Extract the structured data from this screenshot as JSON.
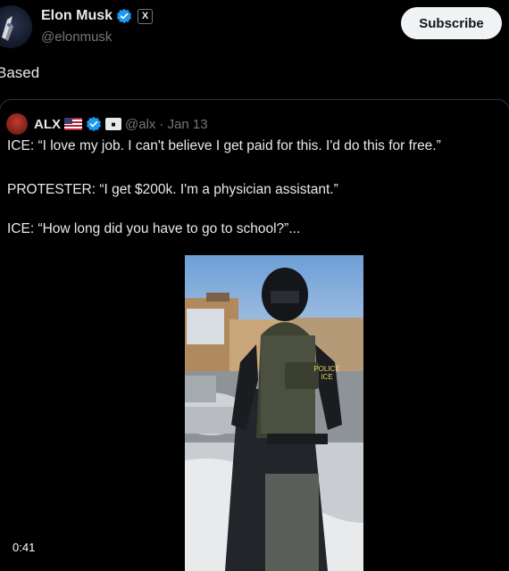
{
  "author": {
    "name": "Elon Musk",
    "handle": "@elonmusk",
    "x_badge": "X"
  },
  "subscribe_label": "Subscribe",
  "tweet_text": "Based",
  "quoted": {
    "name": "ALX",
    "handle": "@alx",
    "date": "· Jan 13",
    "lines": [
      "ICE: “I love my job. I can't believe I get paid for this. I'd do this for free.”",
      "PROTESTER: “I get $200k. I'm a physician assistant.”",
      "ICE: “How long did you have to go to school?”..."
    ],
    "video": {
      "duration": "0:41",
      "vest_text_1": "POLICE",
      "vest_text_2": "ICE"
    }
  },
  "colors": {
    "background": "#000000",
    "text": "#e7e9ea",
    "muted": "#71767b",
    "verified": "#1d9bf0",
    "border": "#2f3336"
  }
}
